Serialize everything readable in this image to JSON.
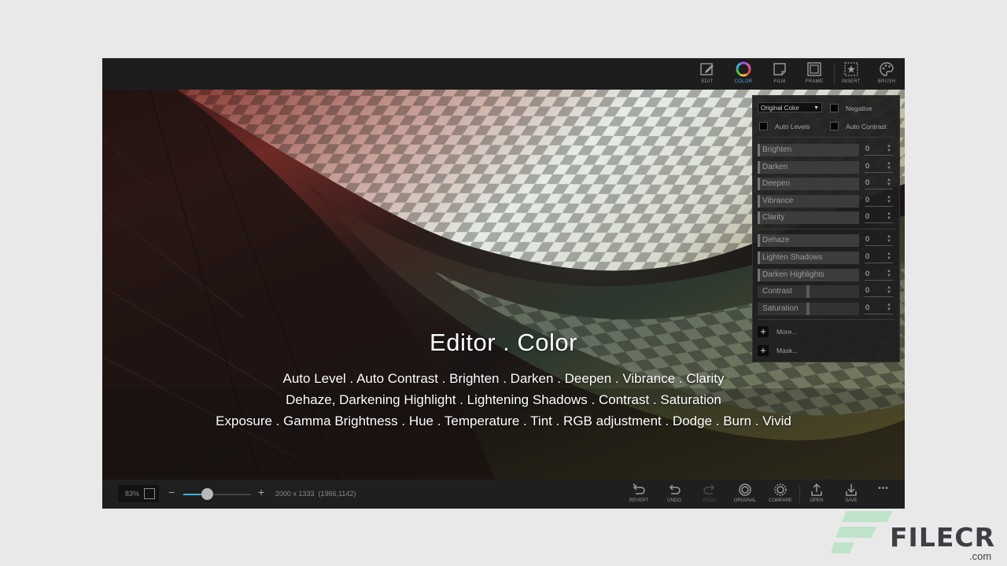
{
  "toolbar": {
    "tools": [
      {
        "label": "EDIT",
        "icon": "edit-icon"
      },
      {
        "label": "COLOR",
        "icon": "color-wheel-icon",
        "active": true
      },
      {
        "label": "FILM",
        "icon": "film-icon"
      },
      {
        "label": "FRAME",
        "icon": "frame-icon"
      },
      {
        "label": "INSERT",
        "icon": "insert-star-icon"
      },
      {
        "label": "BRUSH",
        "icon": "palette-icon"
      }
    ],
    "accent": "#3fb0e8"
  },
  "canvas": {
    "title": "Editor . Color",
    "lines": [
      "Auto Level . Auto Contrast . Brighten . Darken . Deepen . Vibrance . Clarity",
      "Dehaze, Darkening Highlight . Lightening Shadows . Contrast . Saturation",
      "Exposure . Gamma Brightness . Hue . Temperature . Tint . RGB adjustment . Dodge . Burn . Vivid"
    ]
  },
  "panel": {
    "mode": "Original Color",
    "negative": "Negative",
    "auto_levels": "Auto Levels",
    "auto_contrast": "Auto Contrast",
    "sliders": [
      {
        "label": "Brighten",
        "value": "0"
      },
      {
        "label": "Darken",
        "value": "0"
      },
      {
        "label": "Deepen",
        "value": "0"
      },
      {
        "label": "Vibrance",
        "value": "0"
      },
      {
        "label": "Clarity",
        "value": "0"
      },
      {
        "label": "Dehaze",
        "value": "0"
      },
      {
        "label": "Lighten Shadows",
        "value": "0"
      },
      {
        "label": "Darken Highlights",
        "value": "0"
      },
      {
        "label": "Contrast",
        "value": "0"
      },
      {
        "label": "Saturation",
        "value": "0"
      }
    ],
    "more": "More...",
    "mask": "Mask..."
  },
  "bottombar": {
    "zoom": "83%",
    "zoom_minus": "−",
    "zoom_plus": "+",
    "zoom_slider_fraction": 0.35,
    "dimensions": "2000 x 1333",
    "coords": "(1966,1142)",
    "buttons": [
      {
        "label": "REVERT",
        "icon": "revert-icon"
      },
      {
        "label": "UNDO",
        "icon": "undo-icon"
      },
      {
        "label": "REDO",
        "icon": "redo-icon",
        "disabled": true
      },
      {
        "label": "ORIGINAL",
        "icon": "original-icon"
      },
      {
        "label": "COMPARE",
        "icon": "compare-icon"
      },
      {
        "label": "OPEN",
        "icon": "open-icon"
      },
      {
        "label": "SAVE",
        "icon": "save-icon"
      }
    ],
    "more": "•••"
  },
  "watermark": {
    "brand": "FILECR",
    "suffix": ".com"
  }
}
